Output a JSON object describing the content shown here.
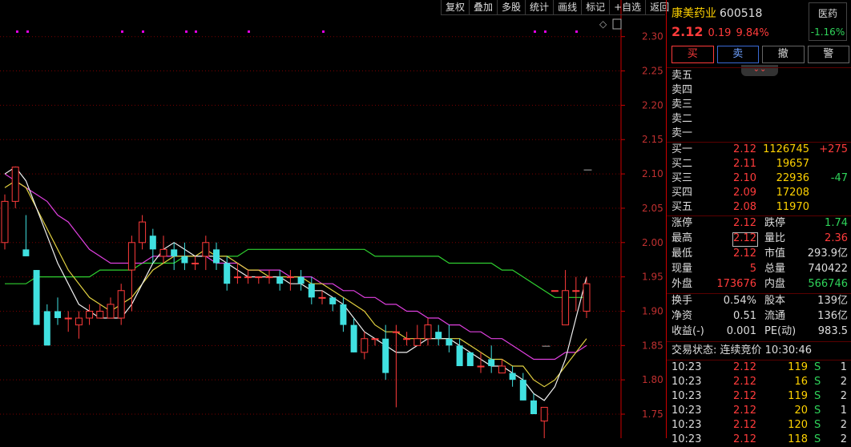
{
  "toolbar": [
    "复权",
    "叠加",
    "多股",
    "统计",
    "画线",
    "标记",
    "+自选",
    "返回"
  ],
  "stock": {
    "name": "康美药业",
    "code": "600518",
    "price": "2.12",
    "change": "0.19",
    "pct": "9.84%",
    "sector_name": "医药",
    "sector_change": "-1.16%"
  },
  "trade_buttons": [
    "买",
    "卖",
    "撤",
    "警"
  ],
  "sell_levels": [
    "卖五",
    "卖四",
    "卖三",
    "卖二",
    "卖一"
  ],
  "buy_levels": [
    {
      "label": "买一",
      "price": "2.12",
      "vol": "1126745",
      "delta": "+275"
    },
    {
      "label": "买二",
      "price": "2.11",
      "vol": "19657",
      "delta": ""
    },
    {
      "label": "买三",
      "price": "2.10",
      "vol": "22936",
      "delta": "-47"
    },
    {
      "label": "买四",
      "price": "2.09",
      "vol": "17208",
      "delta": ""
    },
    {
      "label": "买五",
      "price": "2.08",
      "vol": "11970",
      "delta": ""
    }
  ],
  "stats": [
    {
      "l1": "涨停",
      "v1": "2.12",
      "l2": "跌停",
      "v2": "1.74",
      "c1": "red",
      "c2": "grn"
    },
    {
      "l1": "最高",
      "v1": "2.12",
      "l2": "量比",
      "v2": "2.36",
      "c1": "red",
      "c2": "red"
    },
    {
      "l1": "最低",
      "v1": "2.12",
      "l2": "市值",
      "v2": "293.9亿",
      "c1": "red",
      "c2": "wht"
    },
    {
      "l1": "现量",
      "v1": "5",
      "l2": "总量",
      "v2": "740422",
      "c1": "red",
      "c2": "wht"
    },
    {
      "l1": "外盘",
      "v1": "173676",
      "l2": "内盘",
      "v2": "566746",
      "c1": "red",
      "c2": "grn"
    }
  ],
  "stats2": [
    {
      "l1": "换手",
      "v1": "0.54%",
      "l2": "股本",
      "v2": "139亿"
    },
    {
      "l1": "净资",
      "v1": "0.51",
      "l2": "流通",
      "v2": "136亿"
    },
    {
      "l1": "收益(-)",
      "v1": "0.001",
      "l2": "PE(动)",
      "v2": "983.5"
    }
  ],
  "trade_status": "交易状态: 连续竞价 10:30:46",
  "ticks": [
    {
      "t": "10:23",
      "p": "2.12",
      "v": "119",
      "s": "S",
      "n": "1"
    },
    {
      "t": "10:23",
      "p": "2.12",
      "v": "16",
      "s": "S",
      "n": "2"
    },
    {
      "t": "10:23",
      "p": "2.12",
      "v": "119",
      "s": "S",
      "n": "2"
    },
    {
      "t": "10:23",
      "p": "2.12",
      "v": "20",
      "s": "S",
      "n": "1"
    },
    {
      "t": "10:23",
      "p": "2.12",
      "v": "120",
      "s": "S",
      "n": "2"
    },
    {
      "t": "10:23",
      "p": "2.12",
      "v": "118",
      "s": "S",
      "n": "2"
    }
  ],
  "chart_data": {
    "type": "candlestick",
    "y_ticks": [
      "2.30",
      "2.25",
      "2.20",
      "2.15",
      "2.10",
      "2.05",
      "2.00",
      "1.95",
      "1.90",
      "1.85",
      "1.80",
      "1.75"
    ],
    "ylim": [
      1.715,
      2.33
    ],
    "candles": [
      [
        2.0,
        2.06,
        2.07,
        1.99
      ],
      [
        2.06,
        2.11,
        2.11,
        2.05
      ],
      [
        1.99,
        1.98,
        2.04,
        1.98
      ],
      [
        1.96,
        1.88,
        1.96,
        1.88
      ],
      [
        1.9,
        1.85,
        1.91,
        1.85
      ],
      [
        1.9,
        1.89,
        1.92,
        1.88
      ],
      [
        1.89,
        1.89,
        1.9,
        1.87
      ],
      [
        1.88,
        1.89,
        1.9,
        1.86
      ],
      [
        1.89,
        1.9,
        1.91,
        1.88
      ],
      [
        1.89,
        1.9,
        1.91,
        1.89
      ],
      [
        1.89,
        1.91,
        1.92,
        1.89
      ],
      [
        1.89,
        1.93,
        1.94,
        1.88
      ],
      [
        1.96,
        2.0,
        2.01,
        1.9
      ],
      [
        2.0,
        2.03,
        2.04,
        1.99
      ],
      [
        2.01,
        1.99,
        2.02,
        1.97
      ],
      [
        1.98,
        1.99,
        2.01,
        1.97
      ],
      [
        1.99,
        1.98,
        2.0,
        1.96
      ],
      [
        1.98,
        1.97,
        2.0,
        1.96
      ],
      [
        1.97,
        1.97,
        1.98,
        1.96
      ],
      [
        1.98,
        2.0,
        2.01,
        1.96
      ],
      [
        1.99,
        1.97,
        2.0,
        1.96
      ],
      [
        1.97,
        1.94,
        1.98,
        1.93
      ],
      [
        1.95,
        1.95,
        1.97,
        1.94
      ],
      [
        1.95,
        1.95,
        1.96,
        1.94
      ],
      [
        1.95,
        1.95,
        1.95,
        1.94
      ],
      [
        1.95,
        1.95,
        1.96,
        1.94
      ],
      [
        1.95,
        1.94,
        1.96,
        1.93
      ],
      [
        1.95,
        1.95,
        1.96,
        1.93
      ],
      [
        1.95,
        1.94,
        1.96,
        1.93
      ],
      [
        1.94,
        1.92,
        1.95,
        1.91
      ],
      [
        1.92,
        1.92,
        1.93,
        1.91
      ],
      [
        1.92,
        1.91,
        1.92,
        1.9
      ],
      [
        1.91,
        1.88,
        1.92,
        1.87
      ],
      [
        1.88,
        1.84,
        1.89,
        1.84
      ],
      [
        1.84,
        1.86,
        1.87,
        1.83
      ],
      [
        1.86,
        1.86,
        1.86,
        1.85
      ],
      [
        1.86,
        1.81,
        1.88,
        1.8
      ],
      [
        1.87,
        1.87,
        1.88,
        1.76
      ],
      [
        1.86,
        1.86,
        1.87,
        1.85
      ],
      [
        1.85,
        1.86,
        1.88,
        1.85
      ],
      [
        1.86,
        1.88,
        1.89,
        1.85
      ],
      [
        1.87,
        1.86,
        1.88,
        1.85
      ],
      [
        1.86,
        1.85,
        1.88,
        1.84
      ],
      [
        1.85,
        1.82,
        1.86,
        1.82
      ],
      [
        1.84,
        1.82,
        1.84,
        1.82
      ],
      [
        1.82,
        1.82,
        1.84,
        1.81
      ],
      [
        1.83,
        1.82,
        1.85,
        1.81
      ],
      [
        1.81,
        1.82,
        1.83,
        1.81
      ],
      [
        1.81,
        1.8,
        1.82,
        1.79
      ],
      [
        1.8,
        1.77,
        1.81,
        1.77
      ],
      [
        1.77,
        1.75,
        1.78,
        1.75
      ],
      [
        1.74,
        1.76,
        1.76,
        1.7
      ],
      [
        1.93,
        1.93,
        1.93,
        1.93
      ],
      [
        1.88,
        1.93,
        1.96,
        1.88
      ],
      [
        1.93,
        1.93,
        1.95,
        1.9
      ],
      [
        1.9,
        1.94,
        1.95,
        1.89
      ]
    ],
    "ma_yellow": [
      2.08,
      2.09,
      2.08,
      2.05,
      2.02,
      1.99,
      1.96,
      1.94,
      1.92,
      1.91,
      1.9,
      1.91,
      1.92,
      1.94,
      1.96,
      1.97,
      1.98,
      1.98,
      1.98,
      1.99,
      1.98,
      1.98,
      1.97,
      1.96,
      1.96,
      1.95,
      1.95,
      1.95,
      1.95,
      1.94,
      1.94,
      1.93,
      1.92,
      1.91,
      1.9,
      1.88,
      1.87,
      1.87,
      1.86,
      1.86,
      1.86,
      1.86,
      1.86,
      1.86,
      1.85,
      1.84,
      1.83,
      1.83,
      1.82,
      1.82,
      1.8,
      1.79,
      1.8,
      1.82,
      1.84,
      1.86
    ],
    "ma_white": [
      2.1,
      2.11,
      2.09,
      2.05,
      2.01,
      1.97,
      1.94,
      1.91,
      1.9,
      1.89,
      1.89,
      1.89,
      1.91,
      1.94,
      1.97,
      1.99,
      2.0,
      1.99,
      1.98,
      1.98,
      1.98,
      1.97,
      1.96,
      1.95,
      1.95,
      1.95,
      1.95,
      1.94,
      1.94,
      1.93,
      1.93,
      1.92,
      1.91,
      1.89,
      1.87,
      1.86,
      1.85,
      1.84,
      1.84,
      1.85,
      1.86,
      1.86,
      1.86,
      1.85,
      1.84,
      1.83,
      1.82,
      1.82,
      1.81,
      1.8,
      1.78,
      1.77,
      1.79,
      1.83,
      1.89,
      1.95
    ],
    "ma_magenta": [
      2.1,
      2.09,
      2.08,
      2.07,
      2.06,
      2.04,
      2.03,
      2.01,
      1.99,
      1.98,
      1.97,
      1.97,
      1.97,
      1.97,
      1.98,
      1.98,
      1.98,
      1.98,
      1.98,
      1.98,
      1.97,
      1.97,
      1.97,
      1.96,
      1.96,
      1.96,
      1.96,
      1.95,
      1.95,
      1.95,
      1.94,
      1.94,
      1.93,
      1.93,
      1.92,
      1.92,
      1.91,
      1.91,
      1.9,
      1.9,
      1.89,
      1.89,
      1.88,
      1.88,
      1.87,
      1.87,
      1.86,
      1.86,
      1.85,
      1.84,
      1.83,
      1.83,
      1.83,
      1.84,
      1.84,
      1.85
    ],
    "ma_green": [
      1.94,
      1.94,
      1.94,
      1.95,
      1.95,
      1.95,
      1.95,
      1.95,
      1.95,
      1.96,
      1.96,
      1.96,
      1.96,
      1.97,
      1.97,
      1.97,
      1.97,
      1.98,
      1.98,
      1.98,
      1.98,
      1.98,
      1.98,
      1.99,
      1.99,
      1.99,
      1.99,
      1.99,
      1.99,
      1.99,
      1.99,
      1.99,
      1.99,
      1.99,
      1.99,
      1.98,
      1.98,
      1.98,
      1.98,
      1.98,
      1.98,
      1.98,
      1.97,
      1.97,
      1.97,
      1.97,
      1.97,
      1.96,
      1.96,
      1.95,
      1.94,
      1.93,
      1.92,
      1.92,
      1.92,
      1.92
    ]
  }
}
